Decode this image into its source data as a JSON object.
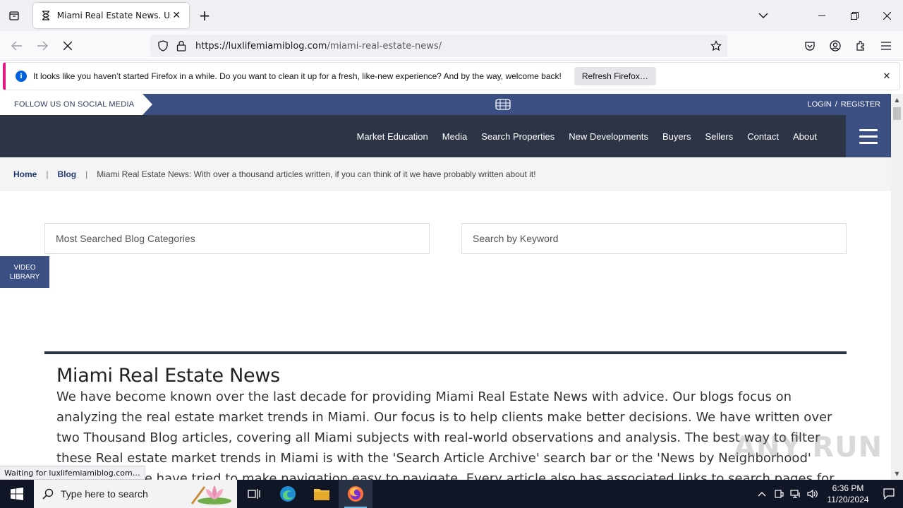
{
  "browser": {
    "tab_title": "Miami Real Estate News. Useful",
    "url_host": "https://luxlifemiamiblog.com",
    "url_path": "/miami-real-estate-news/",
    "notification": "It looks like you haven’t started Firefox in a while. Do you want to clean it up for a fresh, like-new experience? And by the way, welcome back!",
    "refresh_button": "Refresh Firefox…",
    "status_text": "Waiting for luxlifemiamiblog.com…"
  },
  "site": {
    "follow": "FOLLOW US ON SOCIAL MEDIA",
    "login": "LOGIN",
    "login_sep": "/",
    "register": "REGISTER",
    "nav": [
      "Market Education",
      "Media",
      "Search Properties",
      "New Developments",
      "Buyers",
      "Sellers",
      "Contact",
      "About"
    ],
    "breadcrumb": {
      "home": "Home",
      "sep": "|",
      "blog": "Blog",
      "current": "Miami Real Estate News: With over a thousand articles written, if you can think of it we have probably written about it!"
    },
    "category_select": "Most Searched Blog Categories",
    "search_placeholder": "Search by Keyword",
    "video_library": "VIDEO LIBRARY",
    "article_title": "Miami Real Estate News",
    "article_body": "We have become known over the last decade for providing Miami Real Estate News with advice. Our blogs focus on analyzing the real estate market trends in Miami. Our focus is to help clients make better decisions. We have written over two Thousand Blog articles, covering all Miami subjects with real-world observations and analysis. The best way to filter these Real estate market trends in Miami is with the 'Search Article Archive' search bar or the 'News by Neighborhood' Search Bar. We have tried to make navigation easy to navigate. Every article also has associated links to search pages for convenience.",
    "watermark": "ANY RUN"
  },
  "taskbar": {
    "search_placeholder": "Type here to search",
    "time": "6:36 PM",
    "date": "11/20/2024"
  },
  "colors": {
    "nav_dark": "#2d3446",
    "brand_blue": "#3c4f83",
    "notification_accent": "#e31587"
  }
}
